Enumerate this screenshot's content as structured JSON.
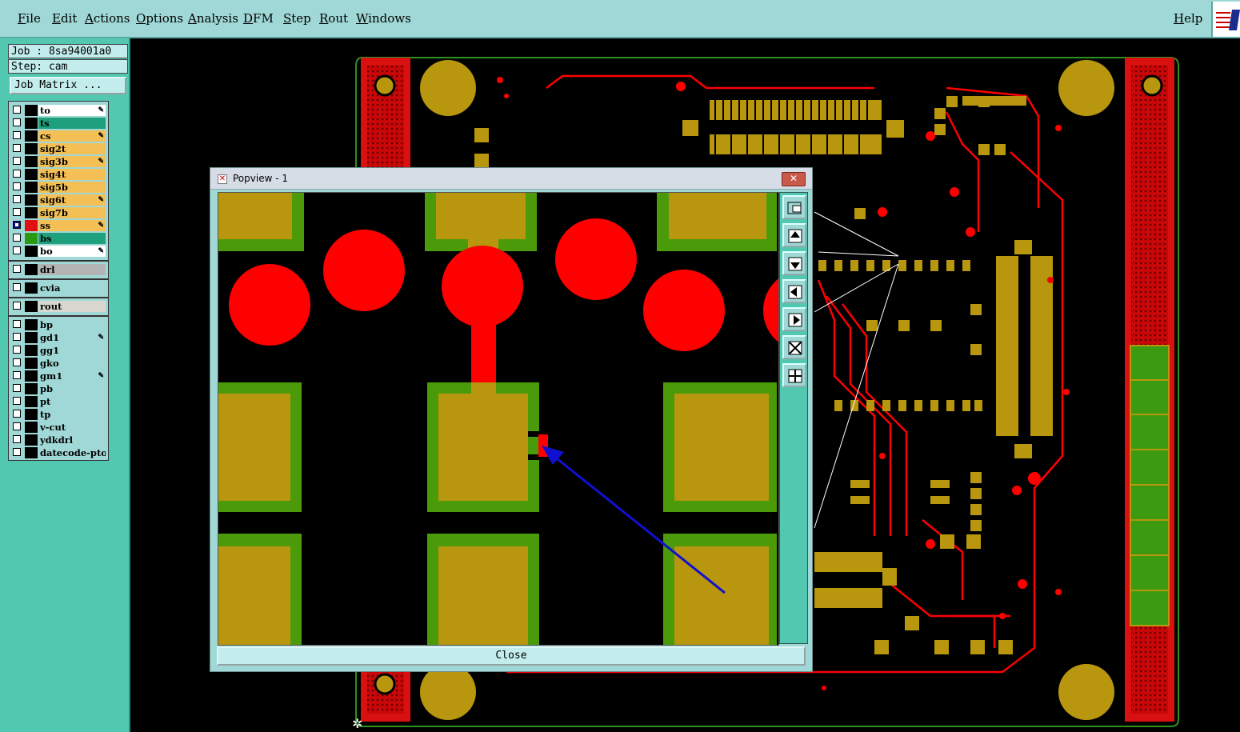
{
  "menu": {
    "items": [
      "File",
      "Edit",
      "Actions",
      "Options",
      "Analysis",
      "DFM",
      "Step",
      "Rout",
      "Windows"
    ],
    "help": "Help"
  },
  "job": {
    "job_label": "Job : 8sa94001a0",
    "step_label": "Step: cam",
    "matrix_button": "Job Matrix ..."
  },
  "layers": [
    {
      "name": "to",
      "color": "#ffffff",
      "edit": true
    },
    {
      "name": "ts",
      "color": "#1fa07c",
      "edit": false
    },
    {
      "name": "cs",
      "color": "#f4c056",
      "edit": true
    },
    {
      "name": "sig2t",
      "color": "#f4c056",
      "edit": false
    },
    {
      "name": "sig3b",
      "color": "#f4c056",
      "edit": true
    },
    {
      "name": "sig4t",
      "color": "#f4c056",
      "edit": false
    },
    {
      "name": "sig5b",
      "color": "#f4c056",
      "edit": false
    },
    {
      "name": "sig6t",
      "color": "#f4c056",
      "edit": true
    },
    {
      "name": "sig7b",
      "color": "#f4c056",
      "edit": false
    },
    {
      "name": "ss",
      "color": "#f4c056",
      "edit": true,
      "active": true
    },
    {
      "name": "bs",
      "color": "#1fa07c",
      "edit": false
    },
    {
      "name": "bo",
      "color": "#ffffff",
      "edit": true
    },
    {
      "name": "drl",
      "color": "#b4b4b4",
      "edit": false
    },
    {
      "name": "cvia",
      "color": "#9fd8d6",
      "edit": false
    },
    {
      "name": "rout",
      "color": "#d8d8d0",
      "edit": false
    },
    {
      "name": "bp",
      "color": "#9fd8d6",
      "edit": false
    },
    {
      "name": "gd1",
      "color": "#9fd8d6",
      "edit": true
    },
    {
      "name": "gg1",
      "color": "#9fd8d6",
      "edit": false
    },
    {
      "name": "gko",
      "color": "#9fd8d6",
      "edit": false
    },
    {
      "name": "gm1",
      "color": "#9fd8d6",
      "edit": true
    },
    {
      "name": "pb",
      "color": "#9fd8d6",
      "edit": false
    },
    {
      "name": "pt",
      "color": "#9fd8d6",
      "edit": false
    },
    {
      "name": "tp",
      "color": "#9fd8d6",
      "edit": false
    },
    {
      "name": "v-cut",
      "color": "#9fd8d6",
      "edit": false
    },
    {
      "name": "ydkdrl",
      "color": "#9fd8d6",
      "edit": false
    },
    {
      "name": "datecode-pto",
      "color": "#9fd8d6",
      "edit": false
    }
  ],
  "popview": {
    "title": "Popview - 1",
    "close_label": "Close",
    "close_icon": "close-x-icon"
  },
  "tools": [
    "zoom-fit-icon",
    "pan-up-icon",
    "pan-down-icon",
    "pan-left-icon",
    "pan-right-icon",
    "zoom-extent-icon",
    "zoom-center-icon"
  ],
  "colors": {
    "pad": "#b8960e",
    "mask": "#4a9a0a",
    "copper": "#ff0000",
    "arrow": "#1010d0",
    "panel": "#53c8b0",
    "menu": "#9fd8d6"
  }
}
